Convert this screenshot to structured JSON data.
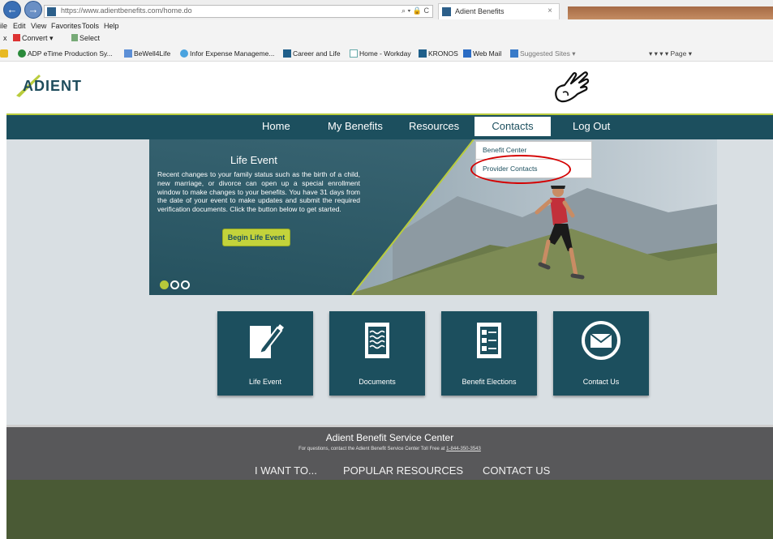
{
  "browser": {
    "url": "https://www.adientbenefits.com/home.do",
    "url_icons": "⌕ ▾ 🔒 C",
    "tab_title": "Adient Benefits",
    "tab_close": "×"
  },
  "menu_bar": {
    "items": [
      "ile",
      "Edit",
      "View",
      "Favorites",
      "Tools",
      "Help"
    ]
  },
  "command_bar": {
    "close": "x",
    "convert": "Convert ▾",
    "select": "Select"
  },
  "favorites_bar": {
    "items": [
      "ADP eTime Production Sy...",
      "BeWell4Life",
      "Infor Expense Manageme...",
      "Career and Life",
      "Home - Workday",
      "KRONOS",
      "Web Mail",
      "Suggested Sites ▾"
    ],
    "right_tools": "▾  ▾  ▾  ▾ Page ▾"
  },
  "site": {
    "logo": "ADIENT",
    "nav": {
      "home": "Home",
      "my_benefits": "My Benefits",
      "resources": "Resources",
      "contacts": "Contacts",
      "logout": "Log Out"
    },
    "dropdown": {
      "benefit_center": "Benefit Center",
      "provider_contacts": "Provider Contacts"
    },
    "hero": {
      "title": "Life Event",
      "body": "Recent changes to your family status such as the birth of a child, new marriage, or divorce can open up a special enrollment window to make changes to your benefits. You have 31 days from the date of your event to make updates and submit the required verification documents. Click the button below to get started.",
      "button": "Begin Life Event"
    },
    "tiles": [
      "Life Event",
      "Documents",
      "Benefit Elections",
      "Contact Us"
    ],
    "footer": {
      "title": "Adient Benefit Service Center",
      "subtitle": "For questions, contact the Adient Benefit Service Center Toll Free at",
      "phone": "1-844-350-3543",
      "links": [
        "I WANT TO...",
        "POPULAR RESOURCES",
        "CONTACT US"
      ]
    }
  },
  "colors": {
    "brand_teal": "#1c4f5e",
    "accent_lime": "#c3d33b",
    "annotation_red": "#d40000",
    "footer_gray": "#58585a"
  }
}
